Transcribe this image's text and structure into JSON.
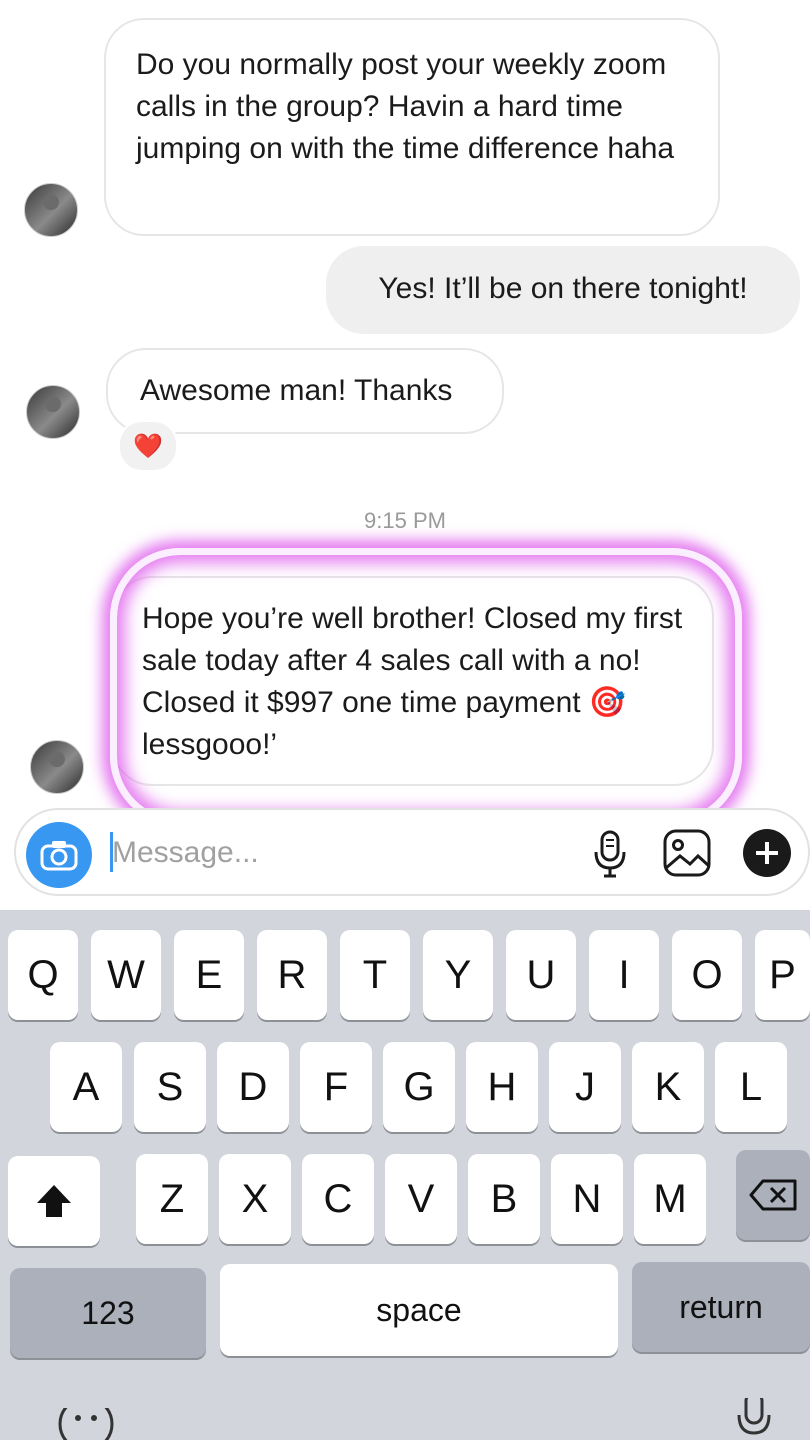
{
  "messages": [
    {
      "sender": "them",
      "text": "Do you normally post your weekly zoom calls in the group? Havin a hard time jumping on with the time difference haha"
    },
    {
      "sender": "me",
      "text": "Yes! It’ll be on there tonight!"
    },
    {
      "sender": "them",
      "text": "Awesome man! Thanks",
      "reaction": "❤️"
    },
    {
      "sender": "them",
      "text": "Hope you’re well brother! Closed my first sale today after 4 sales call with a no! Closed it $997 one time payment 🎯 lessgooo!’"
    }
  ],
  "timestamp": "9:15 PM",
  "composer": {
    "placeholder": "Message...",
    "camera_icon": "camera-icon",
    "mic_icon": "microphone-icon",
    "gallery_icon": "gallery-icon",
    "add_icon": "plus-circle-icon"
  },
  "keyboard": {
    "row1": [
      "Q",
      "W",
      "E",
      "R",
      "T",
      "Y",
      "U",
      "I",
      "O",
      "P"
    ],
    "row2": [
      "A",
      "S",
      "D",
      "F",
      "G",
      "H",
      "J",
      "K",
      "L"
    ],
    "row3": [
      "Z",
      "X",
      "C",
      "V",
      "B",
      "N",
      "M"
    ],
    "shift_icon": "shift-arrow-icon",
    "delete_icon": "backspace-icon",
    "numbers_label": "123",
    "space_label": "space",
    "return_label": "return",
    "emoji_icon": "emoji-icon",
    "dictation_icon": "dictation-mic-icon"
  },
  "colors": {
    "accent": "#3897f0",
    "highlight": "#dc50eb",
    "keyboard_bg": "#d3d5dc"
  }
}
